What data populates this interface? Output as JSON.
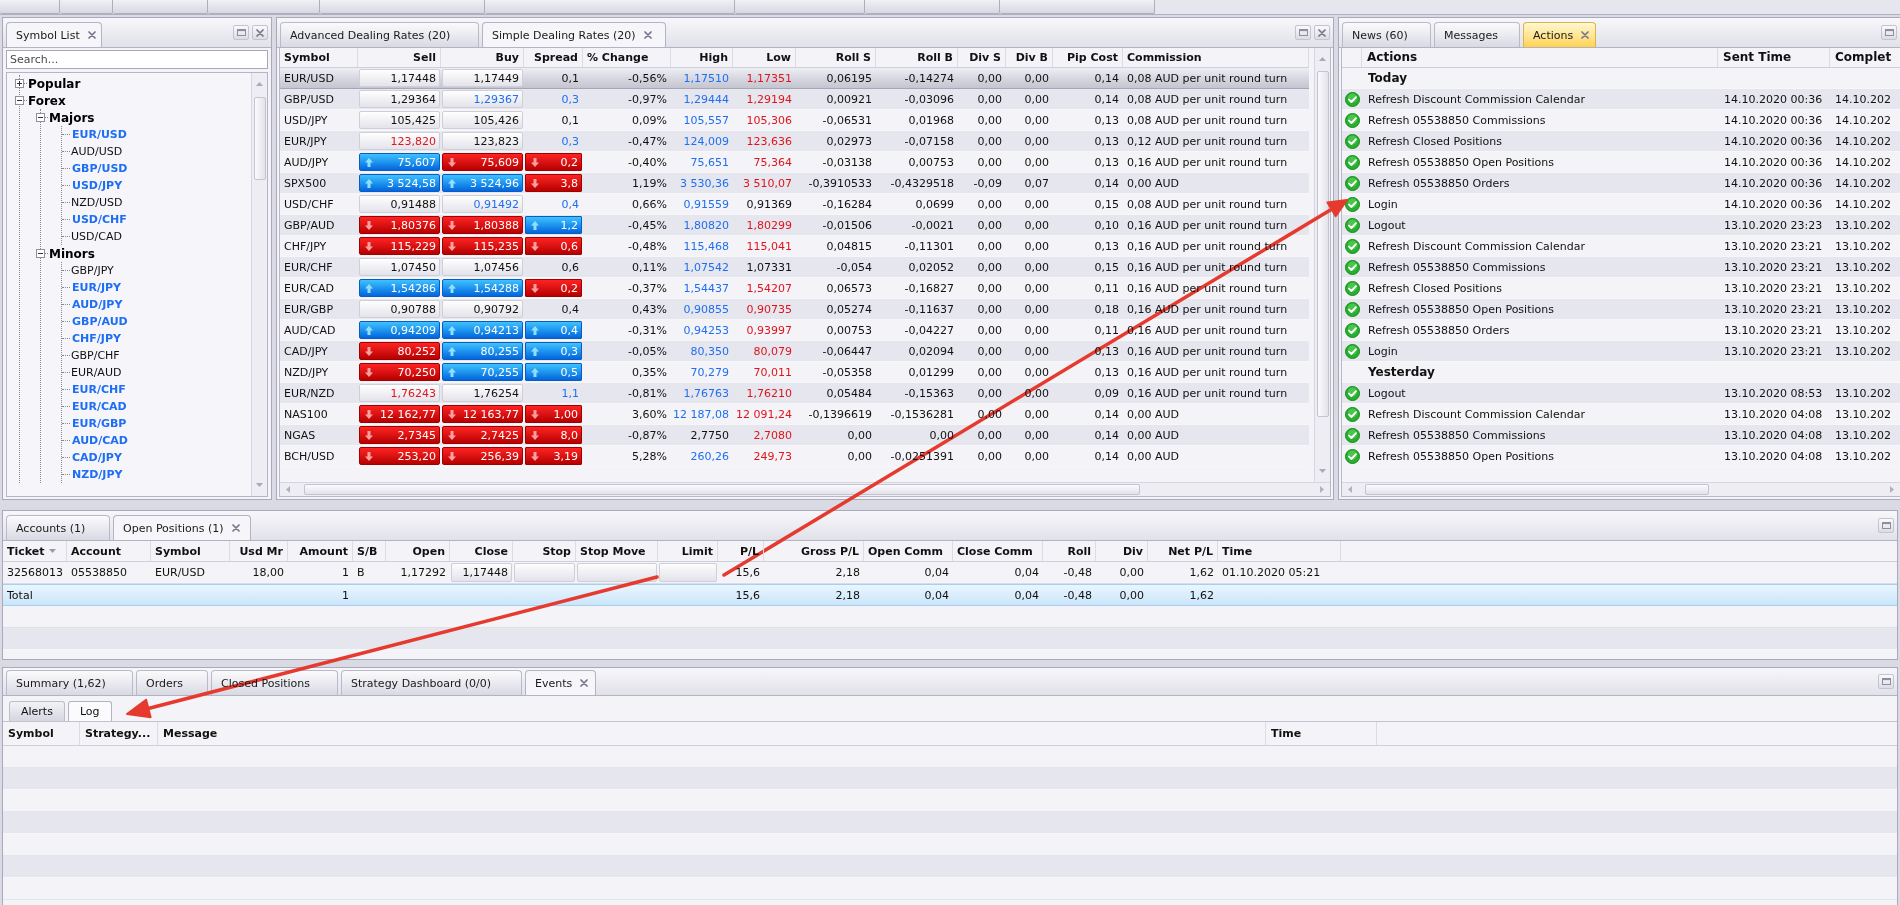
{
  "symbol_list": {
    "tabs": [
      {
        "label": "Symbol List",
        "selected": true
      }
    ],
    "search": {
      "placeholder": "Search..."
    },
    "tree": [
      {
        "label": "Popular",
        "kind": "group",
        "expanded": false
      },
      {
        "label": "Forex",
        "kind": "group",
        "expanded": true,
        "children": [
          {
            "label": "Majors",
            "kind": "group",
            "expanded": true,
            "children": [
              {
                "label": "EUR/USD",
                "kind": "symbol",
                "highlighted": true
              },
              {
                "label": "AUD/USD",
                "kind": "symbol",
                "highlighted": false
              },
              {
                "label": "GBP/USD",
                "kind": "symbol",
                "highlighted": true
              },
              {
                "label": "USD/JPY",
                "kind": "symbol",
                "highlighted": true
              },
              {
                "label": "NZD/USD",
                "kind": "symbol",
                "highlighted": false
              },
              {
                "label": "USD/CHF",
                "kind": "symbol",
                "highlighted": true
              },
              {
                "label": "USD/CAD",
                "kind": "symbol",
                "highlighted": false
              }
            ]
          },
          {
            "label": "Minors",
            "kind": "group",
            "expanded": true,
            "children": [
              {
                "label": "GBP/JPY",
                "kind": "symbol",
                "highlighted": false
              },
              {
                "label": "EUR/JPY",
                "kind": "symbol",
                "highlighted": true
              },
              {
                "label": "AUD/JPY",
                "kind": "symbol",
                "highlighted": true
              },
              {
                "label": "GBP/AUD",
                "kind": "symbol",
                "highlighted": true
              },
              {
                "label": "CHF/JPY",
                "kind": "symbol",
                "highlighted": true
              },
              {
                "label": "GBP/CHF",
                "kind": "symbol",
                "highlighted": false
              },
              {
                "label": "EUR/AUD",
                "kind": "symbol",
                "highlighted": false
              },
              {
                "label": "EUR/CHF",
                "kind": "symbol",
                "highlighted": true
              },
              {
                "label": "EUR/CAD",
                "kind": "symbol",
                "highlighted": true
              },
              {
                "label": "EUR/GBP",
                "kind": "symbol",
                "highlighted": true
              },
              {
                "label": "AUD/CAD",
                "kind": "symbol",
                "highlighted": true
              },
              {
                "label": "CAD/JPY",
                "kind": "symbol",
                "highlighted": true
              },
              {
                "label": "NZD/JPY",
                "kind": "symbol",
                "highlighted": true
              }
            ]
          }
        ]
      }
    ]
  },
  "dealing_rates": {
    "tabs": [
      {
        "label": "Advanced Dealing Rates (20)",
        "selected": false
      },
      {
        "label": "Simple Dealing Rates (20)",
        "selected": true
      }
    ],
    "columns": [
      "Symbol",
      "Sell",
      "Buy",
      "Spread",
      "% Change",
      "High",
      "Low",
      "Roll S",
      "Roll B",
      "Div S",
      "Div B",
      "Pip Cost",
      "Commission"
    ],
    "rows": [
      {
        "selected": true,
        "symbol": "EUR/USD",
        "sell": {
          "value": "1,17448",
          "up": false,
          "down": false,
          "flash": false
        },
        "buy": {
          "value": "1,17449",
          "up": false,
          "down": false,
          "flash": false
        },
        "spread": {
          "value": "0,1",
          "up": false,
          "down": false,
          "flash": false
        },
        "change": "-0,56%",
        "high": {
          "value": "1,17510",
          "highlighted": true
        },
        "low": {
          "value": "1,17351",
          "highlighted": true
        },
        "roll_s": "0,06195",
        "roll_b": "-0,14274",
        "div_s": "0,00",
        "div_b": "0,00",
        "pip_cost": "0,14",
        "commission": "0,08 AUD per unit round turn"
      },
      {
        "selected": false,
        "symbol": "GBP/USD",
        "sell": {
          "value": "1,29364",
          "up": false,
          "down": false,
          "flash": false
        },
        "buy": {
          "value": "1,29367",
          "up": true,
          "down": false,
          "flash": false
        },
        "spread": {
          "value": "0,3",
          "up": true,
          "down": false,
          "flash": false
        },
        "change": "-0,97%",
        "high": {
          "value": "1,29444",
          "highlighted": true
        },
        "low": {
          "value": "1,29194",
          "highlighted": true
        },
        "roll_s": "0,00921",
        "roll_b": "-0,03096",
        "div_s": "0,00",
        "div_b": "0,00",
        "pip_cost": "0,14",
        "commission": "0,08 AUD per unit round turn"
      },
      {
        "selected": false,
        "symbol": "USD/JPY",
        "sell": {
          "value": "105,425",
          "up": false,
          "down": false,
          "flash": false
        },
        "buy": {
          "value": "105,426",
          "up": false,
          "down": false,
          "flash": false
        },
        "spread": {
          "value": "0,1",
          "up": false,
          "down": false,
          "flash": false
        },
        "change": "0,09%",
        "high": {
          "value": "105,557",
          "highlighted": true
        },
        "low": {
          "value": "105,306",
          "highlighted": true
        },
        "roll_s": "-0,06531",
        "roll_b": "0,01968",
        "div_s": "0,00",
        "div_b": "0,00",
        "pip_cost": "0,13",
        "commission": "0,08 AUD per unit round turn"
      },
      {
        "selected": false,
        "symbol": "EUR/JPY",
        "sell": {
          "value": "123,820",
          "up": false,
          "down": true,
          "flash": false
        },
        "buy": {
          "value": "123,823",
          "up": false,
          "down": false,
          "flash": false
        },
        "spread": {
          "value": "0,3",
          "up": true,
          "down": false,
          "flash": false
        },
        "change": "-0,47%",
        "high": {
          "value": "124,009",
          "highlighted": true
        },
        "low": {
          "value": "123,636",
          "highlighted": true
        },
        "roll_s": "0,02973",
        "roll_b": "-0,07158",
        "div_s": "0,00",
        "div_b": "0,00",
        "pip_cost": "0,13",
        "commission": "0,12 AUD per unit round turn"
      },
      {
        "selected": false,
        "symbol": "AUD/JPY",
        "sell": {
          "value": "75,607",
          "up": true,
          "down": false,
          "flash": true
        },
        "buy": {
          "value": "75,609",
          "up": false,
          "down": true,
          "flash": true
        },
        "spread": {
          "value": "0,2",
          "up": false,
          "down": true,
          "flash": true
        },
        "change": "-0,40%",
        "high": {
          "value": "75,651",
          "highlighted": true
        },
        "low": {
          "value": "75,364",
          "highlighted": true
        },
        "roll_s": "-0,03138",
        "roll_b": "0,00753",
        "div_s": "0,00",
        "div_b": "0,00",
        "pip_cost": "0,13",
        "commission": "0,16 AUD per unit round turn"
      },
      {
        "selected": false,
        "symbol": "SPX500",
        "sell": {
          "value": "3 524,58",
          "up": true,
          "down": false,
          "flash": true
        },
        "buy": {
          "value": "3 524,96",
          "up": true,
          "down": false,
          "flash": true
        },
        "spread": {
          "value": "3,8",
          "up": false,
          "down": true,
          "flash": true
        },
        "change": "1,19%",
        "high": {
          "value": "3 530,36",
          "highlighted": true
        },
        "low": {
          "value": "3 510,07",
          "highlighted": true
        },
        "roll_s": "-0,3910533",
        "roll_b": "-0,4329518",
        "div_s": "-0,09",
        "div_b": "0,07",
        "pip_cost": "0,14",
        "commission": "0,00 AUD"
      },
      {
        "selected": false,
        "symbol": "USD/CHF",
        "sell": {
          "value": "0,91488",
          "up": false,
          "down": false,
          "flash": false
        },
        "buy": {
          "value": "0,91492",
          "up": true,
          "down": false,
          "flash": false
        },
        "spread": {
          "value": "0,4",
          "up": true,
          "down": false,
          "flash": false
        },
        "change": "0,66%",
        "high": {
          "value": "0,91559",
          "highlighted": true
        },
        "low": {
          "value": "0,91369",
          "highlighted": false
        },
        "roll_s": "-0,16284",
        "roll_b": "0,0699",
        "div_s": "0,00",
        "div_b": "0,00",
        "pip_cost": "0,15",
        "commission": "0,08 AUD per unit round turn"
      },
      {
        "selected": false,
        "symbol": "GBP/AUD",
        "sell": {
          "value": "1,80376",
          "up": false,
          "down": true,
          "flash": true
        },
        "buy": {
          "value": "1,80388",
          "up": false,
          "down": true,
          "flash": true
        },
        "spread": {
          "value": "1,2",
          "up": true,
          "down": false,
          "flash": true
        },
        "change": "-0,45%",
        "high": {
          "value": "1,80820",
          "highlighted": true
        },
        "low": {
          "value": "1,80299",
          "highlighted": true
        },
        "roll_s": "-0,01506",
        "roll_b": "-0,0021",
        "div_s": "0,00",
        "div_b": "0,00",
        "pip_cost": "0,10",
        "commission": "0,16 AUD per unit round turn"
      },
      {
        "selected": false,
        "symbol": "CHF/JPY",
        "sell": {
          "value": "115,229",
          "up": false,
          "down": true,
          "flash": true
        },
        "buy": {
          "value": "115,235",
          "up": false,
          "down": true,
          "flash": true
        },
        "spread": {
          "value": "0,6",
          "up": false,
          "down": true,
          "flash": true
        },
        "change": "-0,48%",
        "high": {
          "value": "115,468",
          "highlighted": true
        },
        "low": {
          "value": "115,041",
          "highlighted": true
        },
        "roll_s": "0,04815",
        "roll_b": "-0,11301",
        "div_s": "0,00",
        "div_b": "0,00",
        "pip_cost": "0,13",
        "commission": "0,16 AUD per unit round turn"
      },
      {
        "selected": false,
        "symbol": "EUR/CHF",
        "sell": {
          "value": "1,07450",
          "up": false,
          "down": false,
          "flash": false
        },
        "buy": {
          "value": "1,07456",
          "up": false,
          "down": false,
          "flash": false
        },
        "spread": {
          "value": "0,6",
          "up": false,
          "down": false,
          "flash": false
        },
        "change": "0,11%",
        "high": {
          "value": "1,07542",
          "highlighted": true
        },
        "low": {
          "value": "1,07331",
          "highlighted": false
        },
        "roll_s": "-0,054",
        "roll_b": "0,02052",
        "div_s": "0,00",
        "div_b": "0,00",
        "pip_cost": "0,15",
        "commission": "0,16 AUD per unit round turn"
      },
      {
        "selected": false,
        "symbol": "EUR/CAD",
        "sell": {
          "value": "1,54286",
          "up": true,
          "down": false,
          "flash": true
        },
        "buy": {
          "value": "1,54288",
          "up": true,
          "down": false,
          "flash": true
        },
        "spread": {
          "value": "0,2",
          "up": false,
          "down": true,
          "flash": true
        },
        "change": "-0,37%",
        "high": {
          "value": "1,54437",
          "highlighted": true
        },
        "low": {
          "value": "1,54207",
          "highlighted": true
        },
        "roll_s": "0,06573",
        "roll_b": "-0,16827",
        "div_s": "0,00",
        "div_b": "0,00",
        "pip_cost": "0,11",
        "commission": "0,16 AUD per unit round turn"
      },
      {
        "selected": false,
        "symbol": "EUR/GBP",
        "sell": {
          "value": "0,90788",
          "up": false,
          "down": false,
          "flash": false
        },
        "buy": {
          "value": "0,90792",
          "up": false,
          "down": false,
          "flash": false
        },
        "spread": {
          "value": "0,4",
          "up": false,
          "down": false,
          "flash": false
        },
        "change": "0,43%",
        "high": {
          "value": "0,90855",
          "highlighted": true
        },
        "low": {
          "value": "0,90735",
          "highlighted": true
        },
        "roll_s": "0,05274",
        "roll_b": "-0,11637",
        "div_s": "0,00",
        "div_b": "0,00",
        "pip_cost": "0,18",
        "commission": "0,16 AUD per unit round turn"
      },
      {
        "selected": false,
        "symbol": "AUD/CAD",
        "sell": {
          "value": "0,94209",
          "up": true,
          "down": false,
          "flash": true
        },
        "buy": {
          "value": "0,94213",
          "up": true,
          "down": false,
          "flash": true
        },
        "spread": {
          "value": "0,4",
          "up": true,
          "down": false,
          "flash": true
        },
        "change": "-0,31%",
        "high": {
          "value": "0,94253",
          "highlighted": true
        },
        "low": {
          "value": "0,93997",
          "highlighted": true
        },
        "roll_s": "0,00753",
        "roll_b": "-0,04227",
        "div_s": "0,00",
        "div_b": "0,00",
        "pip_cost": "0,11",
        "commission": "0,16 AUD per unit round turn"
      },
      {
        "selected": false,
        "symbol": "CAD/JPY",
        "sell": {
          "value": "80,252",
          "up": false,
          "down": true,
          "flash": true
        },
        "buy": {
          "value": "80,255",
          "up": true,
          "down": false,
          "flash": true
        },
        "spread": {
          "value": "0,3",
          "up": true,
          "down": false,
          "flash": true
        },
        "change": "-0,05%",
        "high": {
          "value": "80,350",
          "highlighted": true
        },
        "low": {
          "value": "80,079",
          "highlighted": true
        },
        "roll_s": "-0,06447",
        "roll_b": "0,02094",
        "div_s": "0,00",
        "div_b": "0,00",
        "pip_cost": "0,13",
        "commission": "0,16 AUD per unit round turn"
      },
      {
        "selected": false,
        "symbol": "NZD/JPY",
        "sell": {
          "value": "70,250",
          "up": false,
          "down": true,
          "flash": true
        },
        "buy": {
          "value": "70,255",
          "up": true,
          "down": false,
          "flash": true
        },
        "spread": {
          "value": "0,5",
          "up": true,
          "down": false,
          "flash": true
        },
        "change": "0,35%",
        "high": {
          "value": "70,279",
          "highlighted": true
        },
        "low": {
          "value": "70,011",
          "highlighted": true
        },
        "roll_s": "-0,05358",
        "roll_b": "0,01299",
        "div_s": "0,00",
        "div_b": "0,00",
        "pip_cost": "0,13",
        "commission": "0,16 AUD per unit round turn"
      },
      {
        "selected": false,
        "symbol": "EUR/NZD",
        "sell": {
          "value": "1,76243",
          "up": false,
          "down": true,
          "flash": false
        },
        "buy": {
          "value": "1,76254",
          "up": false,
          "down": false,
          "flash": false
        },
        "spread": {
          "value": "1,1",
          "up": true,
          "down": false,
          "flash": false
        },
        "change": "-0,81%",
        "high": {
          "value": "1,76763",
          "highlighted": true
        },
        "low": {
          "value": "1,76210",
          "highlighted": true
        },
        "roll_s": "0,05484",
        "roll_b": "-0,15363",
        "div_s": "0,00",
        "div_b": "0,00",
        "pip_cost": "0,09",
        "commission": "0,16 AUD per unit round turn"
      },
      {
        "selected": false,
        "symbol": "NAS100",
        "sell": {
          "value": "12 162,77",
          "up": false,
          "down": true,
          "flash": true
        },
        "buy": {
          "value": "12 163,77",
          "up": false,
          "down": true,
          "flash": true
        },
        "spread": {
          "value": "1,00",
          "up": false,
          "down": true,
          "flash": true
        },
        "change": "3,60%",
        "high": {
          "value": "12 187,08",
          "highlighted": true
        },
        "low": {
          "value": "12 091,24",
          "highlighted": true
        },
        "roll_s": "-0,1396619",
        "roll_b": "-0,1536281",
        "div_s": "0,00",
        "div_b": "0,00",
        "pip_cost": "0,14",
        "commission": "0,00 AUD"
      },
      {
        "selected": false,
        "symbol": "NGAS",
        "sell": {
          "value": "2,7345",
          "up": false,
          "down": true,
          "flash": true
        },
        "buy": {
          "value": "2,7425",
          "up": false,
          "down": true,
          "flash": true
        },
        "spread": {
          "value": "8,0",
          "up": false,
          "down": true,
          "flash": true
        },
        "change": "-0,87%",
        "high": {
          "value": "2,7750",
          "highlighted": false
        },
        "low": {
          "value": "2,7080",
          "highlighted": true
        },
        "roll_s": "0,00",
        "roll_b": "0,00",
        "div_s": "0,00",
        "div_b": "0,00",
        "pip_cost": "0,14",
        "commission": "0,00 AUD"
      },
      {
        "selected": false,
        "symbol": "BCH/USD",
        "sell": {
          "value": "253,20",
          "up": false,
          "down": true,
          "flash": true
        },
        "buy": {
          "value": "256,39",
          "up": false,
          "down": true,
          "flash": true
        },
        "spread": {
          "value": "3,19",
          "up": false,
          "down": true,
          "flash": true
        },
        "change": "5,28%",
        "high": {
          "value": "260,26",
          "highlighted": true
        },
        "low": {
          "value": "249,73",
          "highlighted": true
        },
        "roll_s": "0,00",
        "roll_b": "-0,0251391",
        "div_s": "0,00",
        "div_b": "0,00",
        "pip_cost": "0,14",
        "commission": "0,00 AUD"
      }
    ]
  },
  "news_panel": {
    "tabs": [
      {
        "label": "News (60)",
        "selected": false,
        "highlighted": false
      },
      {
        "label": "Messages",
        "selected": false,
        "highlighted": false
      },
      {
        "label": "Actions",
        "selected": true,
        "highlighted": true
      }
    ],
    "columns": [
      "Actions",
      "Sent Time",
      "Complet"
    ],
    "groups": [
      {
        "label": "Today",
        "items": [
          {
            "done": true,
            "action": "Refresh Discount Commission Calendar",
            "sent": "14.10.2020 00:36",
            "completed": "14.10.202"
          },
          {
            "done": true,
            "action": "Refresh 05538850 Commissions",
            "sent": "14.10.2020 00:36",
            "completed": "14.10.202"
          },
          {
            "done": true,
            "action": "Refresh Closed Positions",
            "sent": "14.10.2020 00:36",
            "completed": "14.10.202"
          },
          {
            "done": true,
            "action": "Refresh 05538850 Open Positions",
            "sent": "14.10.2020 00:36",
            "completed": "14.10.202"
          },
          {
            "done": true,
            "action": "Refresh 05538850 Orders",
            "sent": "14.10.2020 00:36",
            "completed": "14.10.202"
          },
          {
            "done": true,
            "action": "Login",
            "sent": "14.10.2020 00:36",
            "completed": "14.10.202"
          },
          {
            "done": true,
            "action": "Logout",
            "sent": "13.10.2020 23:23",
            "completed": "13.10.202"
          },
          {
            "done": true,
            "action": "Refresh Discount Commission Calendar",
            "sent": "13.10.2020 23:21",
            "completed": "13.10.202"
          },
          {
            "done": true,
            "action": "Refresh 05538850 Commissions",
            "sent": "13.10.2020 23:21",
            "completed": "13.10.202"
          },
          {
            "done": true,
            "action": "Refresh Closed Positions",
            "sent": "13.10.2020 23:21",
            "completed": "13.10.202"
          },
          {
            "done": true,
            "action": "Refresh 05538850 Open Positions",
            "sent": "13.10.2020 23:21",
            "completed": "13.10.202"
          },
          {
            "done": true,
            "action": "Refresh 05538850 Orders",
            "sent": "13.10.2020 23:21",
            "completed": "13.10.202"
          },
          {
            "done": true,
            "action": "Login",
            "sent": "13.10.2020 23:21",
            "completed": "13.10.202"
          }
        ]
      },
      {
        "label": "Yesterday",
        "items": [
          {
            "done": true,
            "action": "Logout",
            "sent": "13.10.2020 08:53",
            "completed": "13.10.202"
          },
          {
            "done": true,
            "action": "Refresh Discount Commission Calendar",
            "sent": "13.10.2020 04:08",
            "completed": "13.10.202"
          },
          {
            "done": true,
            "action": "Refresh 05538850 Commissions",
            "sent": "13.10.2020 04:08",
            "completed": "13.10.202"
          },
          {
            "done": true,
            "action": "Refresh 05538850 Open Positions",
            "sent": "13.10.2020 04:08",
            "completed": "13.10.202"
          }
        ]
      }
    ]
  },
  "positions_panel": {
    "tabs": [
      {
        "label": "Accounts (1)",
        "selected": false
      },
      {
        "label": "Open Positions (1)",
        "selected": true
      }
    ],
    "columns": [
      {
        "label": "Ticket",
        "sorted": true
      },
      {
        "label": "Account",
        "sorted": false
      },
      {
        "label": "Symbol",
        "sorted": false
      },
      {
        "label": "Usd Mr",
        "sorted": false
      },
      {
        "label": "Amount",
        "sorted": false
      },
      {
        "label": "S/B",
        "sorted": false
      },
      {
        "label": "Open",
        "sorted": false
      },
      {
        "label": "Close",
        "sorted": false
      },
      {
        "label": "Stop",
        "sorted": false
      },
      {
        "label": "Stop Move",
        "sorted": false
      },
      {
        "label": "Limit",
        "sorted": false
      },
      {
        "label": "P/L",
        "sorted": false
      },
      {
        "label": "Gross P/L",
        "sorted": false
      },
      {
        "label": "Open Comm",
        "sorted": false
      },
      {
        "label": "Close Comm",
        "sorted": false
      },
      {
        "label": "Roll",
        "sorted": false
      },
      {
        "label": "Div",
        "sorted": false
      },
      {
        "label": "Net P/L",
        "sorted": false
      },
      {
        "label": "Time",
        "sorted": false
      }
    ],
    "rows": [
      {
        "kind": "position",
        "ticket": "32568013",
        "account": "05538850",
        "symbol": "EUR/USD",
        "usd_mr": "18,00",
        "amount": "1",
        "s_b": "B",
        "open": "1,17292",
        "close": "1,17448",
        "p_l": "15,6",
        "gross_p_l": "2,18",
        "open_comm": "0,04",
        "close_comm": "0,04",
        "roll": "-0,48",
        "div": "0,00",
        "net_p_l": "1,62",
        "time": "01.10.2020 05:21"
      },
      {
        "kind": "total",
        "label": "Total",
        "amount": "1",
        "p_l": "15,6",
        "gross_p_l": "2,18",
        "open_comm": "0,04",
        "close_comm": "0,04",
        "roll": "-0,48",
        "div": "0,00",
        "net_p_l": "1,62"
      }
    ]
  },
  "events_panel": {
    "tabs": [
      {
        "label": "Summary (1,62)",
        "selected": false
      },
      {
        "label": "Orders",
        "selected": false
      },
      {
        "label": "Closed Positions",
        "selected": false
      },
      {
        "label": "Strategy Dashboard (0/0)",
        "selected": false
      },
      {
        "label": "Events",
        "selected": true
      }
    ],
    "subtabs": [
      {
        "label": "Alerts",
        "selected": false
      },
      {
        "label": "Log",
        "selected": true
      }
    ],
    "columns": [
      "Symbol",
      "Strategy...",
      "Message",
      "Time"
    ]
  }
}
